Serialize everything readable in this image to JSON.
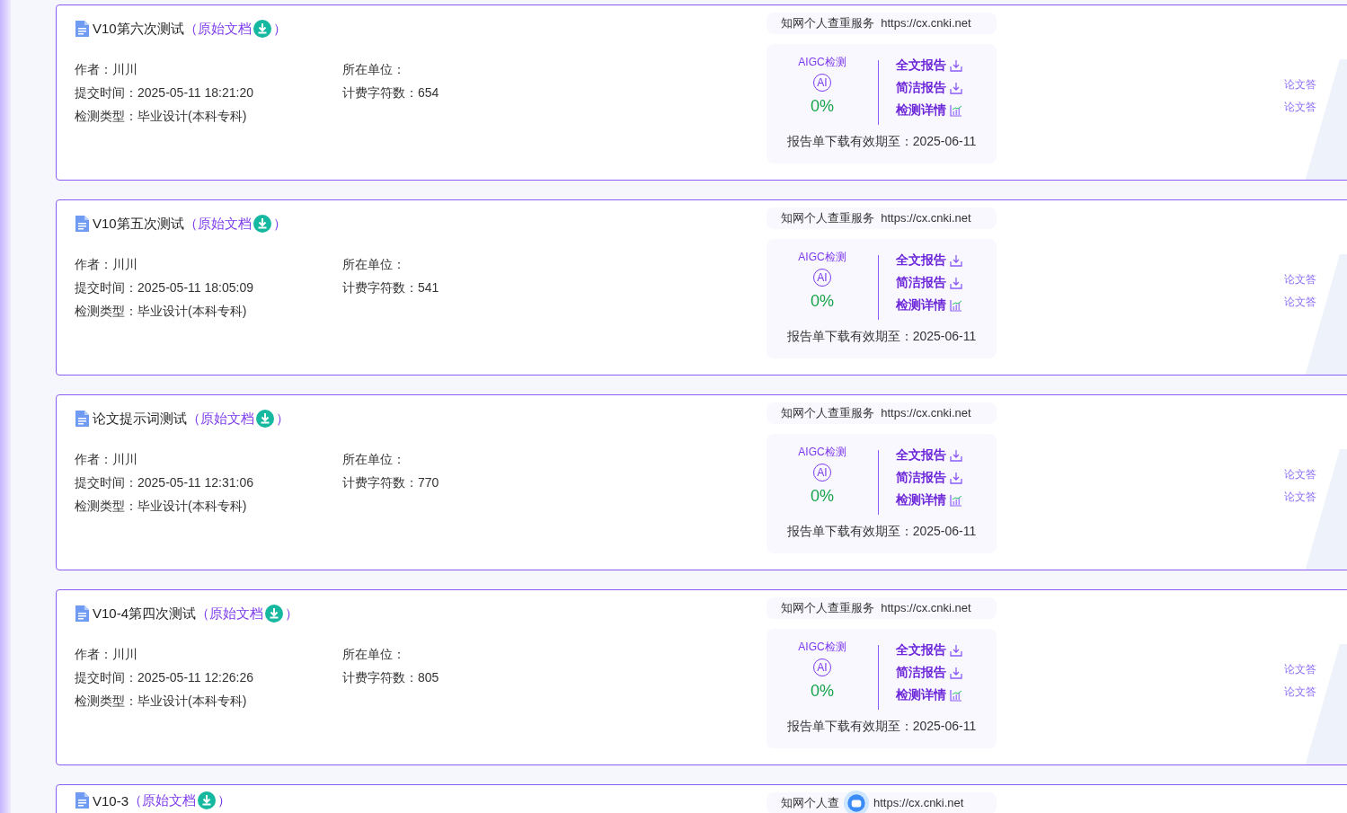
{
  "records": [
    {
      "title": "V10第六次测试",
      "source_link": "（原始文档",
      "close_paren": "）",
      "left_fields": [
        {
          "label": "作者：",
          "value": "川川"
        },
        {
          "label": "提交时间：",
          "value": "2025-05-11 18:21:20"
        },
        {
          "label": "检测类型：",
          "value": "毕业设计(本科专科)"
        }
      ],
      "right_fields": [
        {
          "label": "所在单位："
        },
        {
          "label": "计费字符数：",
          "value": "654"
        }
      ],
      "service": "知网个人查重服务",
      "url": "https://cx.cnki.net",
      "aigc_label": "AIGC检测",
      "ai_badge": "AI",
      "score": "0%",
      "actions": [
        {
          "label": "全文报告",
          "kind": "download"
        },
        {
          "label": "简洁报告",
          "kind": "download"
        },
        {
          "label": "检测详情",
          "kind": "chart"
        }
      ],
      "expiry": "报告单下载有效期至：2025-06-11",
      "side_links": [
        "论文答",
        "论文答"
      ]
    },
    {
      "title": "V10第五次测试",
      "source_link": "（原始文档",
      "close_paren": "）",
      "left_fields": [
        {
          "label": "作者：",
          "value": "川川"
        },
        {
          "label": "提交时间：",
          "value": "2025-05-11 18:05:09"
        },
        {
          "label": "检测类型：",
          "value": "毕业设计(本科专科)"
        }
      ],
      "right_fields": [
        {
          "label": "所在单位："
        },
        {
          "label": "计费字符数：",
          "value": "541"
        }
      ],
      "service": "知网个人查重服务",
      "url": "https://cx.cnki.net",
      "aigc_label": "AIGC检测",
      "ai_badge": "AI",
      "score": "0%",
      "actions": [
        {
          "label": "全文报告",
          "kind": "download"
        },
        {
          "label": "简洁报告",
          "kind": "download"
        },
        {
          "label": "检测详情",
          "kind": "chart"
        }
      ],
      "expiry": "报告单下载有效期至：2025-06-11",
      "side_links": [
        "论文答",
        "论文答"
      ]
    },
    {
      "title": "论文提示词测试",
      "source_link": "（原始文档",
      "close_paren": "）",
      "left_fields": [
        {
          "label": "作者：",
          "value": "川川"
        },
        {
          "label": "提交时间：",
          "value": "2025-05-11 12:31:06"
        },
        {
          "label": "检测类型：",
          "value": "毕业设计(本科专科)"
        }
      ],
      "right_fields": [
        {
          "label": "所在单位："
        },
        {
          "label": "计费字符数：",
          "value": "770"
        }
      ],
      "service": "知网个人查重服务",
      "url": "https://cx.cnki.net",
      "aigc_label": "AIGC检测",
      "ai_badge": "AI",
      "score": "0%",
      "actions": [
        {
          "label": "全文报告",
          "kind": "download"
        },
        {
          "label": "简洁报告",
          "kind": "download"
        },
        {
          "label": "检测详情",
          "kind": "chart"
        }
      ],
      "expiry": "报告单下载有效期至：2025-06-11",
      "side_links": [
        "论文答",
        "论文答"
      ]
    },
    {
      "title": "V10-4第四次测试",
      "source_link": "（原始文档",
      "close_paren": "）",
      "left_fields": [
        {
          "label": "作者：",
          "value": "川川"
        },
        {
          "label": "提交时间：",
          "value": "2025-05-11 12:26:26"
        },
        {
          "label": "检测类型：",
          "value": "毕业设计(本科专科)"
        }
      ],
      "right_fields": [
        {
          "label": "所在单位："
        },
        {
          "label": "计费字符数：",
          "value": "805"
        }
      ],
      "service": "知网个人查重服务",
      "url": "https://cx.cnki.net",
      "aigc_label": "AIGC检测",
      "ai_badge": "AI",
      "score": "0%",
      "actions": [
        {
          "label": "全文报告",
          "kind": "download"
        },
        {
          "label": "简洁报告",
          "kind": "download"
        },
        {
          "label": "检测详情",
          "kind": "chart"
        }
      ],
      "expiry": "报告单下载有效期至：2025-06-11",
      "side_links": [
        "论文答",
        "论文答"
      ]
    },
    {
      "title": "V10-3",
      "source_link": "（原始文档",
      "close_paren": "）",
      "service": "知网个人查",
      "url": "https://cx.cnki.net"
    }
  ]
}
